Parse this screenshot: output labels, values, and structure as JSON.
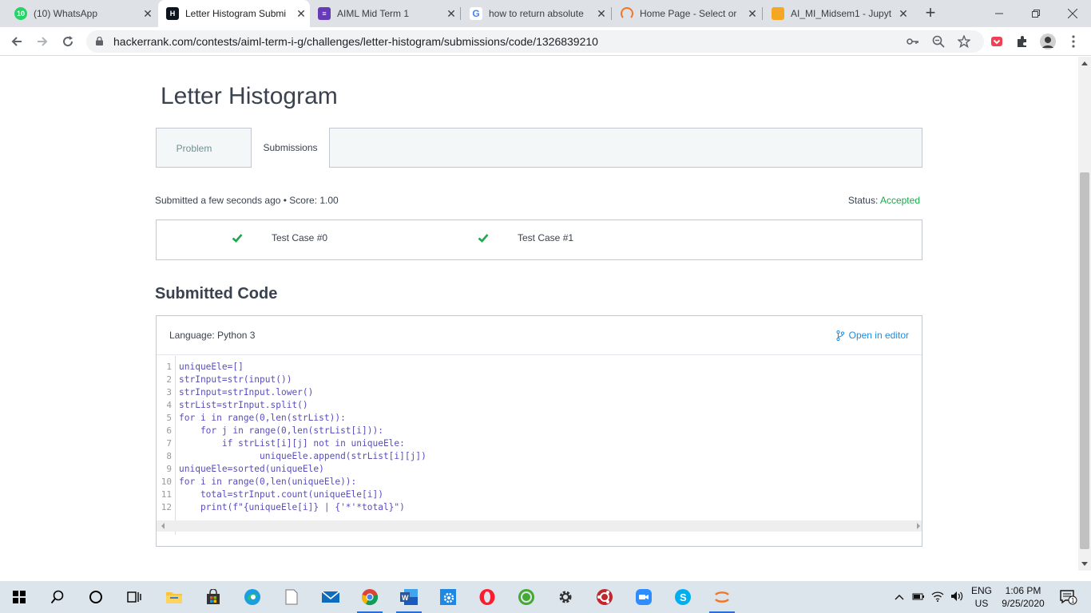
{
  "browser": {
    "tabs": [
      {
        "title": "(10) WhatsApp",
        "active": false
      },
      {
        "title": "Letter Histogram Submi",
        "active": true
      },
      {
        "title": "AIML Mid Term 1",
        "active": false
      },
      {
        "title": "how to return absolute",
        "active": false
      },
      {
        "title": "Home Page - Select or",
        "active": false
      },
      {
        "title": "AI_MI_Midsem1 - Jupyt",
        "active": false
      }
    ],
    "whatsapp_badge": "10",
    "url": "hackerrank.com/contests/aiml-term-i-g/challenges/letter-histogram/submissions/code/1326839210"
  },
  "page": {
    "title": "Letter Histogram",
    "tabs": [
      "Problem",
      "Submissions"
    ],
    "submitted_text": "Submitted a few seconds ago • Score: 1.00",
    "status_label": "Status:",
    "status_value": "Accepted",
    "test_cases": [
      "Test Case #0",
      "Test Case #1"
    ],
    "submitted_code_heading": "Submitted Code",
    "language": "Language: Python 3",
    "open_in_editor": "Open in editor",
    "code_lines": [
      "uniqueEle=[]",
      "strInput=str(input())",
      "strInput=strInput.lower()",
      "strList=strInput.split()",
      "for i in range(0,len(strList)):",
      "    for j in range(0,len(strList[i])):",
      "        if strList[i][j] not in uniqueEle:",
      "               uniqueEle.append(strList[i][j])",
      "uniqueEle=sorted(uniqueEle)",
      "for i in range(0,len(uniqueEle)):",
      "    total=strInput.count(uniqueEle[i])",
      "    print(f\"{uniqueEle[i]} | {'*'*total}\")"
    ]
  },
  "taskbar": {
    "language_top": "ENG",
    "language_bottom": "US",
    "time": "1:06 PM",
    "date": "9/25/2020",
    "notification_count": "1"
  },
  "colors": {
    "accepted": "#1ba94c",
    "link": "#1f8ce0",
    "code": "#5a4ebd"
  }
}
